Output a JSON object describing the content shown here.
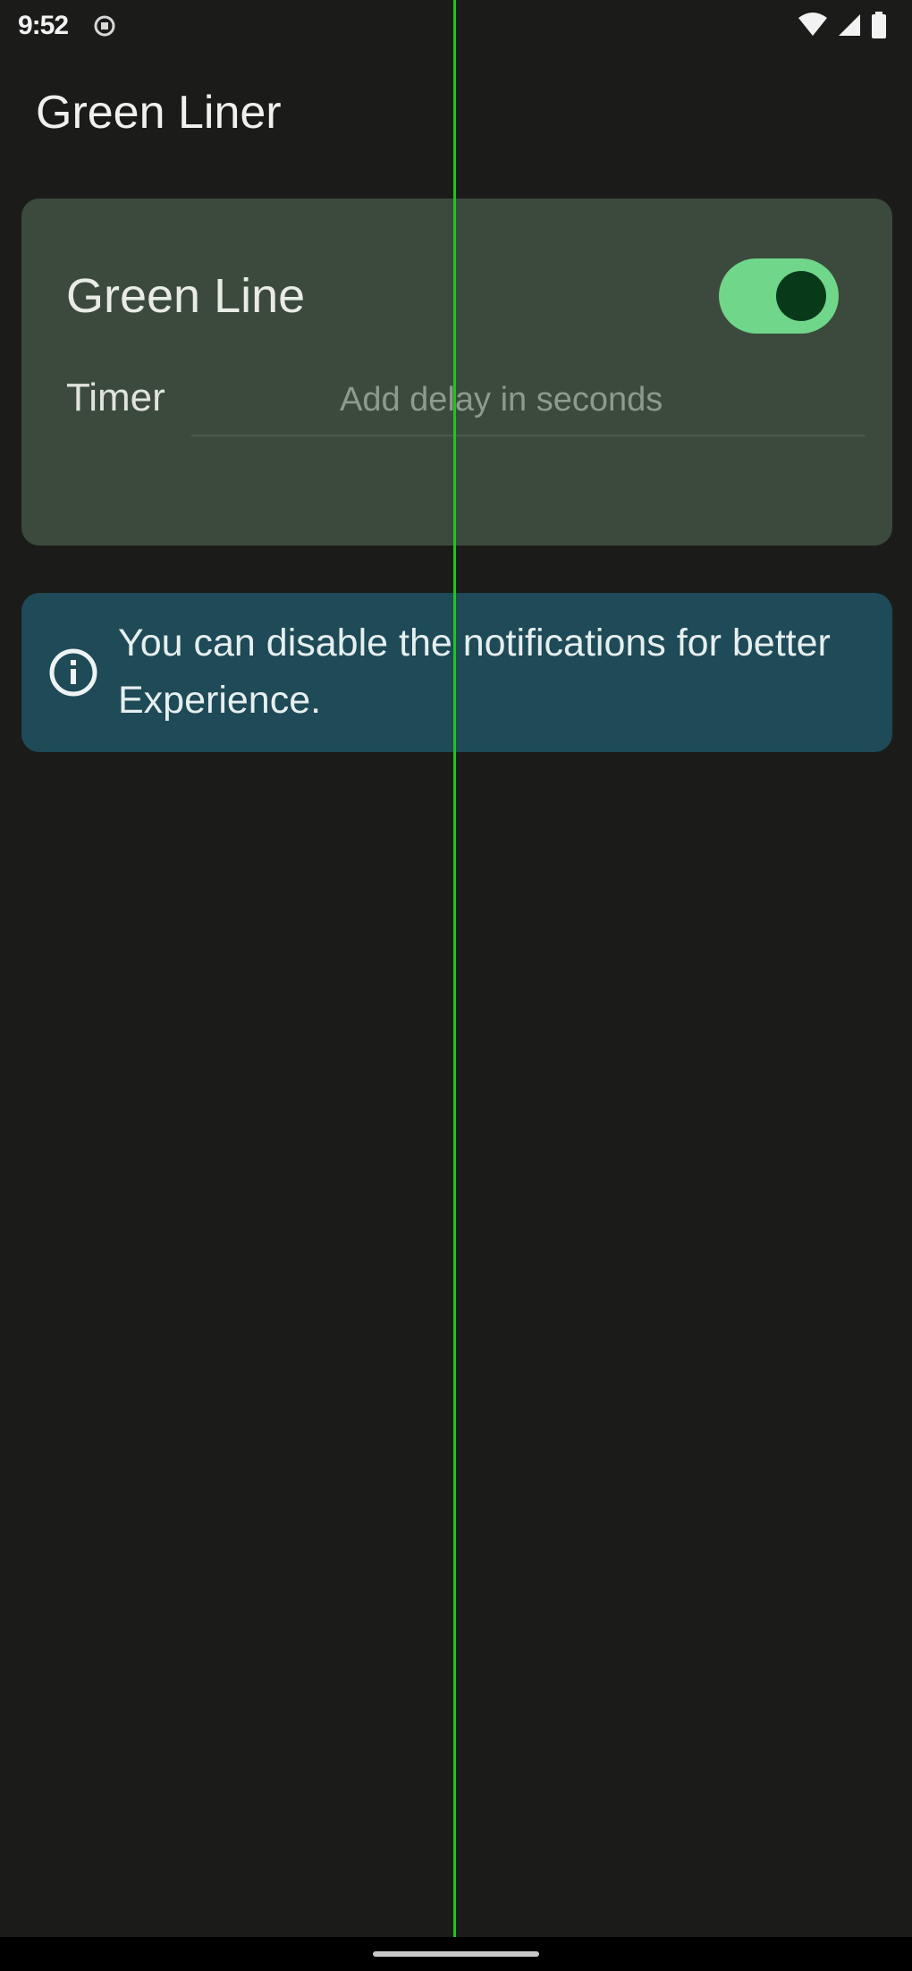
{
  "status_bar": {
    "time": "9:52",
    "icons": [
      "notification-icon",
      "wifi-icon",
      "cellular-signal-icon",
      "battery-icon"
    ]
  },
  "app": {
    "title": "Green Liner"
  },
  "settings_card": {
    "heading": "Green Line",
    "toggle": {
      "on": true
    },
    "timer_label": "Timer",
    "timer_input": {
      "value": "",
      "placeholder": "Add delay in seconds"
    }
  },
  "info_banner": {
    "icon": "info-icon",
    "text": "You can disable the notifications for better Experience."
  },
  "colors": {
    "background": "#1b1c1a",
    "card": "#3b4a3c",
    "toggle_track": "#6fd68a",
    "toggle_thumb": "#083a1a",
    "info_banner": "#1f4a57",
    "overlay_line": "#21c321"
  }
}
